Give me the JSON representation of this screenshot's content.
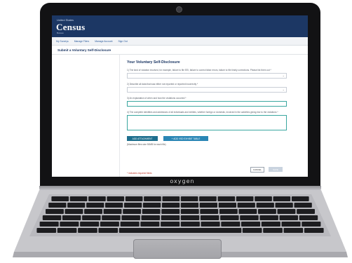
{
  "laptop": {
    "brand": "oxygen"
  },
  "site": {
    "header": {
      "logo_small": "United States",
      "logo": "Census",
      "logo_sub": "Bureau"
    },
    "nav": [
      "My Surveys",
      "Manage Filers",
      "Manage Account",
      "Sign Out"
    ],
    "page_title": "Submit a Voluntary Self-Disclosure",
    "section_title": "Your Voluntary Self-Disclosure",
    "questions": [
      "1) The kind of violation involved, for example, failure to file EEI, failure to correct false errors, failure to file timely corrections. Please list them out *",
      "2) Describe all data that was either not reported or reported incorrectly *",
      "3) An explanation of when and how the violations occurred *",
      "4) The complete identities and addresses of all individuals and entities, whether foreign or domestic, involved in the activities giving rise to the violations *"
    ],
    "buttons": {
      "add_attachment": "ADD ATTACHMENT",
      "add_table": "+ ADD VSD EXHIBIT TABLE",
      "cancel": "CANCEL",
      "save": "SAVE"
    },
    "max_note": "(Maximum files size 50MB for each file)",
    "required_note": "* indicates required fields"
  }
}
